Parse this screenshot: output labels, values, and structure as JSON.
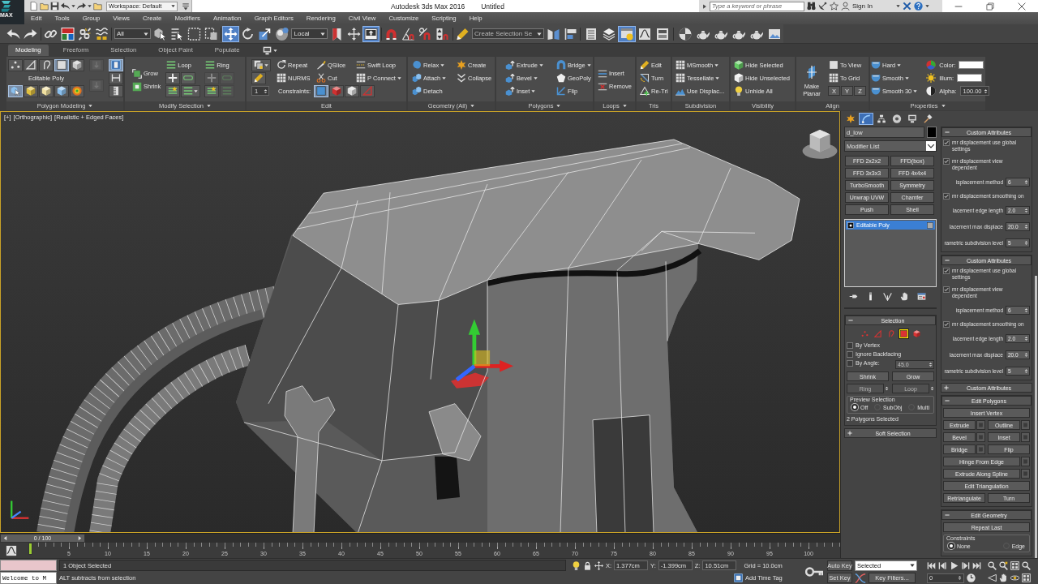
{
  "title_bar": {
    "app_menu_label": "MAX",
    "workspace": "Workspace: Default",
    "title": "Autodesk 3ds Max 2016",
    "document": "Untitled",
    "search": {
      "placeholder": "Type a keyword or phrase"
    },
    "sign_in": "Sign In"
  },
  "menu_bar": [
    "Edit",
    "Tools",
    "Group",
    "Views",
    "Create",
    "Modifiers",
    "Animation",
    "Graph Editors",
    "Rendering",
    "Civil View",
    "Customize",
    "Scripting",
    "Help"
  ],
  "main_toolbar": {
    "selection_filter": "All",
    "reference_coordinate_system": "Local",
    "named_selection_set": "Create Selection Se",
    "tools": [
      {
        "selected": false
      },
      {
        "selected": false
      },
      {
        "selected": false
      },
      {
        "selected": false
      },
      {
        "selected": false
      },
      {
        "selected": false
      },
      {
        "selected": false
      },
      {
        "selected": false
      },
      {
        "selected": false
      },
      {
        "selected": false
      },
      {
        "selected": true
      },
      {
        "selected": false
      },
      {
        "selected": false
      },
      {
        "selected": false
      },
      {
        "selected": false
      },
      {
        "selected": false
      },
      {
        "selected": true
      },
      {
        "selected": false
      },
      {
        "selected": false
      },
      {
        "selected": false
      },
      {
        "selected": false
      },
      {
        "selected": false
      },
      {
        "selected": false
      },
      {
        "selected": false
      },
      {
        "selected": false
      },
      {
        "selected": false
      },
      {
        "selected": true
      },
      {
        "selected": false
      },
      {
        "selected": false
      },
      {
        "selected": false
      },
      {
        "selected": false
      },
      {
        "selected": false
      },
      {
        "selected": false
      },
      {
        "selected": false
      },
      {
        "selected": false
      }
    ]
  },
  "ribbon": {
    "tabs": [
      {
        "label": "Modeling",
        "selected": true
      },
      {
        "label": "Freeform",
        "selected": false
      },
      {
        "label": "Selection",
        "selected": false
      },
      {
        "label": "Object Paint",
        "selected": false
      },
      {
        "label": "Populate",
        "selected": false
      }
    ],
    "panels": [
      {
        "title": "Polygon Modeling",
        "dropdown": true,
        "columns": [
          [
            [
              {
                "kind": "icon",
                "selected": false
              },
              {
                "kind": "icon",
                "selected": false
              },
              {
                "kind": "icon",
                "selected": false
              },
              {
                "kind": "icon",
                "selected": true
              },
              {
                "kind": "icon",
                "selected": false
              }
            ],
            [
              {
                "kind": "caption",
                "label": "Editable Poly"
              }
            ],
            [
              {
                "kind": "icon",
                "selected": true
              },
              {
                "kind": "icon",
                "selected": false
              },
              {
                "kind": "icon",
                "selected": false
              },
              {
                "kind": "icon",
                "selected": false
              },
              {
                "kind": "icon",
                "selected": false
              }
            ]
          ],
          [
            [
              {
                "kind": "icon",
                "disabled": true
              }
            ],
            [
              {
                "kind": "icon",
                "disabled": true
              }
            ]
          ],
          [
            [
              {
                "kind": "icon",
                "selected": true
              }
            ],
            [
              {
                "kind": "icon",
                "selected": false
              }
            ],
            [
              {
                "kind": "icon",
                "selected": false
              }
            ]
          ]
        ]
      },
      {
        "title": "Modify Selection",
        "dropdown": true,
        "columns": [
          [
            [
              {
                "kind": "command",
                "label": "Grow",
                "dropdown": false
              }
            ],
            [
              {
                "kind": "command",
                "label": "Shrink",
                "dropdown": false
              }
            ]
          ],
          [
            [
              {
                "kind": "command",
                "label": "Loop",
                "dropdown": false
              }
            ],
            [
              {
                "kind": "icon",
                "dropdown": false
              },
              {
                "kind": "icon",
                "dropdown": false
              }
            ],
            [
              {
                "kind": "icon",
                "dropdown": false
              },
              {
                "kind": "icon",
                "dropdown": true
              }
            ]
          ],
          [
            [
              {
                "kind": "command",
                "label": "Ring",
                "dropdown": false
              }
            ],
            [
              {
                "kind": "icon",
                "disabled": true
              },
              {
                "kind": "icon",
                "disabled": true
              }
            ],
            [
              {
                "kind": "icon",
                "disabled": false
              },
              {
                "kind": "icon",
                "disabled": true
              }
            ]
          ]
        ]
      },
      {
        "title": "Edit",
        "dropdown": false,
        "columns": [
          [
            [
              {
                "kind": "icon",
                "dropdown": true
              }
            ],
            [
              {
                "kind": "icon",
                "dropdown": false
              }
            ],
            [
              {
                "kind": "spinner",
                "value": "1"
              }
            ]
          ],
          [
            [
              {
                "kind": "command",
                "label": "Repeat",
                "dropdown": false
              },
              {
                "kind": "command",
                "label": "QSlice",
                "dropdown": false
              },
              {
                "kind": "command",
                "label": "Swift Loop",
                "dropdown": false
              }
            ],
            [
              {
                "kind": "command",
                "label": "NURMS",
                "dropdown": false
              },
              {
                "kind": "command",
                "label": "Cut",
                "dropdown": false
              },
              {
                "kind": "command",
                "label": "P Connect",
                "dropdown": true
              }
            ],
            [
              {
                "kind": "label",
                "label": "Constraints:"
              },
              {
                "kind": "icon",
                "selected": true
              },
              {
                "kind": "icon",
                "selected": false
              },
              {
                "kind": "icon",
                "selected": false
              },
              {
                "kind": "icon",
                "selected": false
              }
            ]
          ]
        ]
      },
      {
        "title": "Geometry (All)",
        "dropdown": true,
        "columns": [
          [
            [
              {
                "kind": "command",
                "label": "Relax",
                "dropdown": true
              },
              {
                "kind": "command",
                "label": "Create",
                "dropdown": false
              }
            ],
            [
              {
                "kind": "command",
                "label": "Attach",
                "dropdown": true
              },
              {
                "kind": "command",
                "label": "Collapse",
                "dropdown": false
              }
            ],
            [
              {
                "kind": "command",
                "label": "Detach",
                "dropdown": false
              }
            ]
          ]
        ]
      },
      {
        "title": "Polygons",
        "dropdown": true,
        "columns": [
          [
            [
              {
                "kind": "command",
                "label": "Extrude",
                "dropdown": true
              },
              {
                "kind": "command",
                "label": "Bridge",
                "dropdown": true
              }
            ],
            [
              {
                "kind": "command",
                "label": "Bevel",
                "dropdown": true
              },
              {
                "kind": "command",
                "label": "GeoPoly",
                "dropdown": false
              }
            ],
            [
              {
                "kind": "command",
                "label": "Inset",
                "dropdown": true
              },
              {
                "kind": "command",
                "label": "Flip",
                "dropdown": false
              }
            ]
          ]
        ]
      },
      {
        "title": "Loops",
        "dropdown": true,
        "columns": [
          [
            [
              {
                "kind": "command",
                "label": "Insert",
                "dropdown": false
              }
            ],
            [
              {
                "kind": "command",
                "label": "Remove",
                "dropdown": false
              }
            ]
          ]
        ]
      },
      {
        "title": "Tris",
        "dropdown": false,
        "columns": [
          [
            [
              {
                "kind": "command",
                "label": "Edit",
                "dropdown": false
              }
            ],
            [
              {
                "kind": "command",
                "label": "Turn",
                "dropdown": false
              }
            ],
            [
              {
                "kind": "command",
                "label": "Re-Tri",
                "dropdown": false
              }
            ]
          ]
        ]
      },
      {
        "title": "Subdivision",
        "dropdown": false,
        "columns": [
          [
            [
              {
                "kind": "command",
                "label": "MSmooth",
                "dropdown": true
              }
            ],
            [
              {
                "kind": "command",
                "label": "Tessellate",
                "dropdown": true
              }
            ],
            [
              {
                "kind": "command",
                "label": "Use Displac...",
                "dropdown": false
              }
            ]
          ]
        ]
      },
      {
        "title": "Visibility",
        "dropdown": false,
        "columns": [
          [
            [
              {
                "kind": "command",
                "label": "Hide Selected",
                "dropdown": false
              }
            ],
            [
              {
                "kind": "command",
                "label": "Hide Unselected",
                "dropdown": false
              }
            ],
            [
              {
                "kind": "command",
                "label": "Unhide All",
                "dropdown": false
              }
            ]
          ]
        ]
      },
      {
        "title": "Align",
        "dropdown": false,
        "columns": [
          [
            [
              {
                "kind": "large",
                "label": "Make Planar"
              }
            ]
          ],
          [
            [
              {
                "kind": "command",
                "label": "To View",
                "dropdown": false
              }
            ],
            [
              {
                "kind": "command",
                "label": "To Grid",
                "dropdown": false
              }
            ],
            [
              {
                "kind": "axis",
                "label": "X"
              },
              {
                "kind": "axis",
                "label": "Y"
              },
              {
                "kind": "axis",
                "label": "Z"
              }
            ]
          ]
        ]
      },
      {
        "title": "Properties",
        "dropdown": true,
        "columns": [
          [
            [
              {
                "kind": "command",
                "label": "Hard",
                "dropdown": true
              }
            ],
            [
              {
                "kind": "command",
                "label": "Smooth",
                "dropdown": true
              }
            ],
            [
              {
                "kind": "command",
                "label": "Smooth 30",
                "dropdown": true
              }
            ]
          ],
          [
            [
              {
                "kind": "swatch",
                "label": "Color:",
                "color": "#ffffff"
              }
            ],
            [
              {
                "kind": "swatch",
                "label": "Illum:",
                "color": "#ffffff"
              }
            ],
            [
              {
                "kind": "spinner",
                "label": "Alpha:",
                "value": "100.00"
              }
            ]
          ]
        ]
      }
    ]
  },
  "viewport": {
    "labels": [
      "[+]",
      "[Orthographic]",
      "[Realistic + Edged Faces]"
    ],
    "active": true
  },
  "time_slider": {
    "label": "0 / 100",
    "level": 0
  },
  "track_bar": {
    "labels": [
      "5",
      "10",
      "15",
      "20",
      "25",
      "30",
      "35",
      "40",
      "45",
      "50",
      "55",
      "60",
      "65",
      "70",
      "75",
      "80",
      "85",
      "90",
      "95",
      "100"
    ],
    "level": 0
  },
  "command_panel": {
    "tabs": [
      {
        "selected": false
      },
      {
        "selected": true
      },
      {
        "selected": false
      },
      {
        "selected": false
      },
      {
        "selected": false
      },
      {
        "selected": false
      }
    ],
    "object": {
      "name": "d_low",
      "color": "#000000"
    },
    "modifier_list": "Modifier List",
    "modifier_buttons": [
      "FFD 2x2x2",
      "FFD(box)",
      "FFD 3x3x3",
      "FFD 4x4x4",
      "TurboSmooth",
      "Symmetry",
      "Unwrap UVW",
      "Chamfer",
      "Push",
      "Shell"
    ],
    "modifier_stack": [
      {
        "label": "Editable Poly",
        "selected": true
      }
    ],
    "selection_rollout": {
      "title": "Selection",
      "expanded": true,
      "subobject_levels": [
        {
          "selected": false
        },
        {
          "selected": false
        },
        {
          "selected": false
        },
        {
          "selected": true
        },
        {
          "selected": false
        }
      ],
      "checkboxes": [
        {
          "label": "By Vertex",
          "checked": false
        },
        {
          "label": "Ignore Backfacing",
          "checked": false
        }
      ],
      "by_angle": {
        "label": "By Angle:",
        "checked": false,
        "value": "45.0"
      },
      "buttons": [
        {
          "label": "Shrink",
          "disabled": false,
          "spinner": false
        },
        {
          "label": "Grow",
          "disabled": false,
          "spinner": false
        },
        {
          "label": "Ring",
          "disabled": true,
          "spinner": true
        },
        {
          "label": "Loop",
          "disabled": true,
          "spinner": true
        }
      ],
      "preview_selection": {
        "label": "Preview Selection",
        "options": [
          {
            "label": "Off",
            "selected": true
          },
          {
            "label": "SubObj",
            "selected": false
          },
          {
            "label": "Multi",
            "selected": false
          }
        ]
      },
      "status": "2 Polygons Selected"
    },
    "soft_selection_rollout": {
      "title": "Soft Selection",
      "expanded": false
    },
    "attribute_rollouts": [
      {
        "title": "Custom Attributes",
        "expanded": true,
        "rows": [
          {
            "kind": "check",
            "label": "mr displacement use global settings",
            "checked": true
          },
          {
            "kind": "check",
            "label": "mr displacement view dependent",
            "checked": true
          },
          {
            "kind": "spinner",
            "label": "isplacement method",
            "value": "6"
          },
          {
            "kind": "check",
            "label": "mr displacement smoothing on",
            "checked": true
          },
          {
            "kind": "spinner",
            "label": "lacement edge length",
            "value": "2.0"
          },
          {
            "kind": "spinner",
            "label": "lacement max displace",
            "value": "20.0"
          },
          {
            "kind": "spinner",
            "label": "rametric subdivision level",
            "value": "5"
          }
        ]
      },
      {
        "title": "Custom Attributes",
        "expanded": true,
        "rows": [
          {
            "kind": "check",
            "label": "mr displacement use global settings",
            "checked": true
          },
          {
            "kind": "check",
            "label": "mr displacement view dependent",
            "checked": true
          },
          {
            "kind": "spinner",
            "label": "isplacement method",
            "value": "6"
          },
          {
            "kind": "check",
            "label": "mr displacement smoothing on",
            "checked": true
          },
          {
            "kind": "spinner",
            "label": "lacement edge length",
            "value": "2.0"
          },
          {
            "kind": "spinner",
            "label": "lacement max displace",
            "value": "20.0"
          },
          {
            "kind": "spinner",
            "label": "rametric subdivision level",
            "value": "5"
          }
        ]
      },
      {
        "title": "Custom Attributes",
        "expanded": false
      },
      {
        "title": "Edit Polygons",
        "expanded": true,
        "rows": [
          {
            "kind": "buttons",
            "buttons": [
              {
                "label": "Insert Vertex",
                "settings": false
              }
            ]
          },
          {
            "kind": "buttons",
            "buttons": [
              {
                "label": "Extrude",
                "settings": true
              },
              {
                "label": "Outline",
                "settings": true
              }
            ]
          },
          {
            "kind": "buttons",
            "buttons": [
              {
                "label": "Bevel",
                "settings": true
              },
              {
                "label": "Inset",
                "settings": true
              }
            ]
          },
          {
            "kind": "buttons",
            "buttons": [
              {
                "label": "Bridge",
                "settings": true
              },
              {
                "label": "Flip",
                "settings": false
              }
            ]
          },
          {
            "kind": "buttons",
            "buttons": [
              {
                "label": "Hinge From Edge",
                "settings": true
              }
            ]
          },
          {
            "kind": "buttons",
            "buttons": [
              {
                "label": "Extrude Along Spline",
                "settings": true
              }
            ]
          },
          {
            "kind": "buttons",
            "buttons": [
              {
                "label": "Edit Triangulation",
                "settings": false
              }
            ]
          },
          {
            "kind": "buttons",
            "buttons": [
              {
                "label": "Retriangulate",
                "settings": false
              },
              {
                "label": "Turn",
                "settings": false
              }
            ]
          }
        ]
      },
      {
        "title": "Edit Geometry",
        "expanded": true,
        "rows": [
          {
            "kind": "buttons",
            "buttons": [
              {
                "label": "Repeat Last",
                "settings": false
              }
            ]
          },
          {
            "kind": "radios",
            "label": "Constraints",
            "options": [
              {
                "label": "None",
                "selected": true
              },
              {
                "label": "Edge",
                "selected": false
              }
            ]
          }
        ]
      }
    ]
  },
  "status_bar": {
    "listener_output": "Welcome to M",
    "selection_status": "1 Object Selected",
    "prompt": "ALT subtracts from selection",
    "coordinates": [
      {
        "axis": "X:",
        "value": "1.377cm"
      },
      {
        "axis": "Y:",
        "value": "-1.399cm"
      },
      {
        "axis": "Z:",
        "value": "10.51cm"
      }
    ],
    "grid": "Grid = 10.0cm",
    "add_time_tag": "Add Time Tag",
    "auto_key": {
      "label": "Auto Key",
      "on": false
    },
    "key_mode": "Selected",
    "set_key": "Set Key",
    "key_filters": "Key Filters...",
    "frame": "0"
  }
}
